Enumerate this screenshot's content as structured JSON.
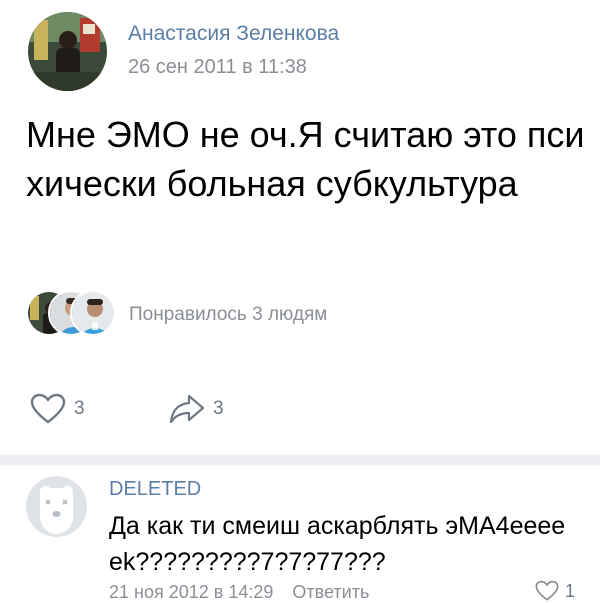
{
  "post": {
    "author": "Анастасия Зеленкова",
    "date": "26 сен 2011 в 11:38",
    "text": "Мне ЭМО не оч.Я считаю это психически больная субкультура",
    "liked_by_text": "Понравилось 3 людям",
    "likes_count": "3",
    "shares_count": "3"
  },
  "comment": {
    "author": "DELETED",
    "text": "Да как ти смеиш аскарблять эМА4eeeeek?????????7?7?77???",
    "date": "21 ноя 2012 в 14:29",
    "reply_label": "Ответить",
    "likes_count": "1"
  },
  "icons": {
    "like": "heart-outline-icon",
    "share": "share-arrow-icon",
    "deleted_avatar": "deleted-user-dog-icon"
  },
  "colors": {
    "name_link": "#5a7ea8",
    "meta_gray": "#8a8f96",
    "icon_gray": "#6d7782",
    "divider": "#ebedf0"
  }
}
